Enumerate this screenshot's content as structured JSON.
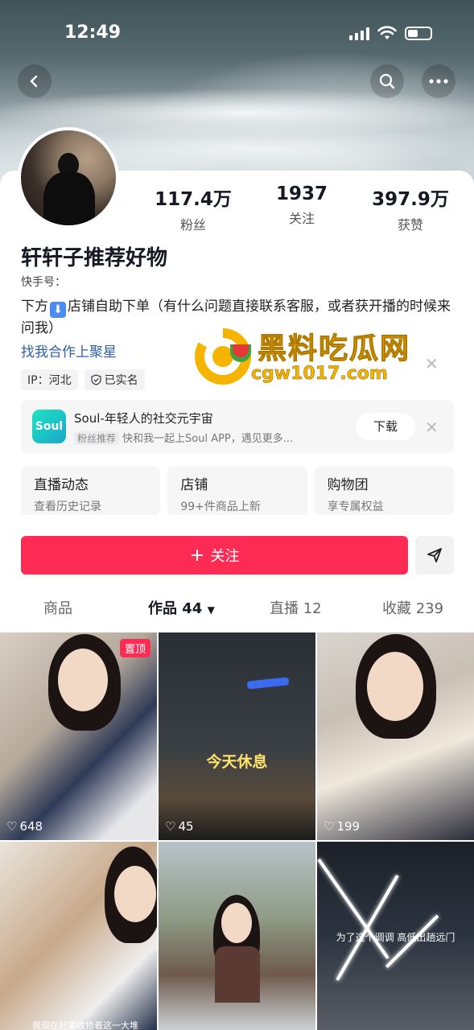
{
  "status_bar": {
    "time": "12:49"
  },
  "profile": {
    "stats": [
      {
        "value": "117.4万",
        "label": "粉丝"
      },
      {
        "value": "1937",
        "label": "关注"
      },
      {
        "value": "397.9万",
        "label": "获赞"
      }
    ],
    "name": "轩轩子推荐好物",
    "kuaishou_id": "快手号：",
    "bio_part1": "下方",
    "bio_emoji": "⬇",
    "bio_part2": "店铺自助下单（有什么问题直接联系客服，或者获开播的时候来问我）",
    "link_text": "找我合作上聚星",
    "tags": {
      "ip": "IP：河北",
      "verified": "已实名"
    }
  },
  "watermark": {
    "title": "黑料吃瓜网",
    "url": "cgw1017.com"
  },
  "ad": {
    "icon_text": "Soul",
    "title": "Soul-年轻人的社交元宇宙",
    "chip": "粉丝推荐",
    "desc": "快和我一起上Soul APP，遇见更多...",
    "button": "下载"
  },
  "services": [
    {
      "title": "直播动态",
      "sub": "查看历史记录"
    },
    {
      "title": "店铺",
      "sub": "99+件商品上新"
    },
    {
      "title": "购物团",
      "sub": "享专属权益"
    }
  ],
  "follow_label": "关注",
  "tabs": [
    {
      "label": "商品"
    },
    {
      "label": "作品 44"
    },
    {
      "label": "直播 12"
    },
    {
      "label": "收藏 239"
    }
  ],
  "videos": [
    {
      "likes": "648",
      "pinned": "置顶"
    },
    {
      "likes": "45",
      "overlay": "今天休息"
    },
    {
      "likes": "199"
    },
    {
      "caption": "我现在赶紧收拾着这一大堆"
    },
    {},
    {
      "overlay": "为了这个调调 高低出趟远门"
    }
  ],
  "colors": {
    "accent": "#fe2c55",
    "link": "#2f5fa8",
    "watermark": "#f5b400"
  }
}
